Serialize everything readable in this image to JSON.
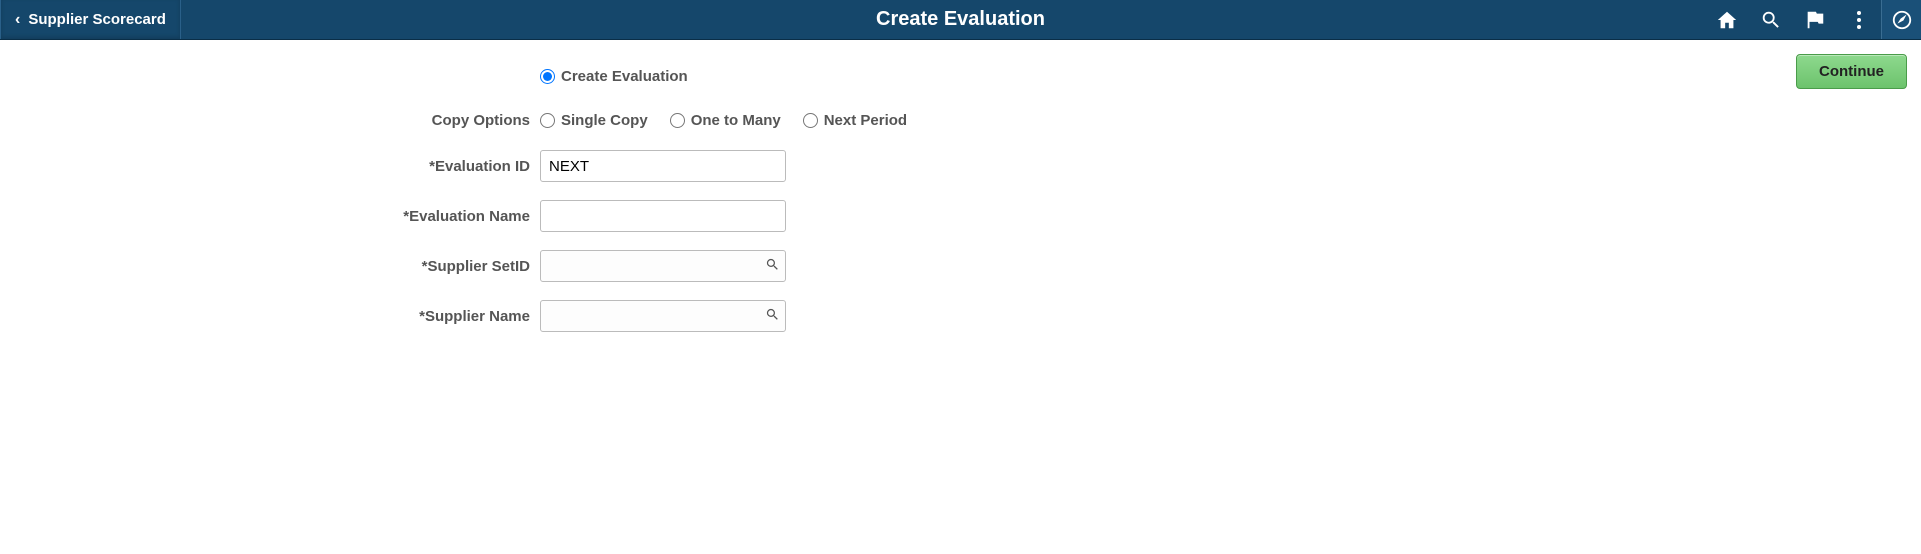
{
  "header": {
    "back_label": "Supplier Scorecard",
    "title": "Create Evaluation"
  },
  "buttons": {
    "continue": "Continue"
  },
  "form": {
    "radio_main": {
      "create_evaluation": "Create Evaluation"
    },
    "copy_options": {
      "label": "Copy Options",
      "single_copy": "Single Copy",
      "one_to_many": "One to Many",
      "next_period": "Next Period"
    },
    "evaluation_id": {
      "label": "*Evaluation ID",
      "value": "NEXT"
    },
    "evaluation_name": {
      "label": "*Evaluation Name",
      "value": ""
    },
    "supplier_setid": {
      "label": "*Supplier SetID",
      "value": ""
    },
    "supplier_name": {
      "label": "*Supplier Name",
      "value": ""
    }
  }
}
